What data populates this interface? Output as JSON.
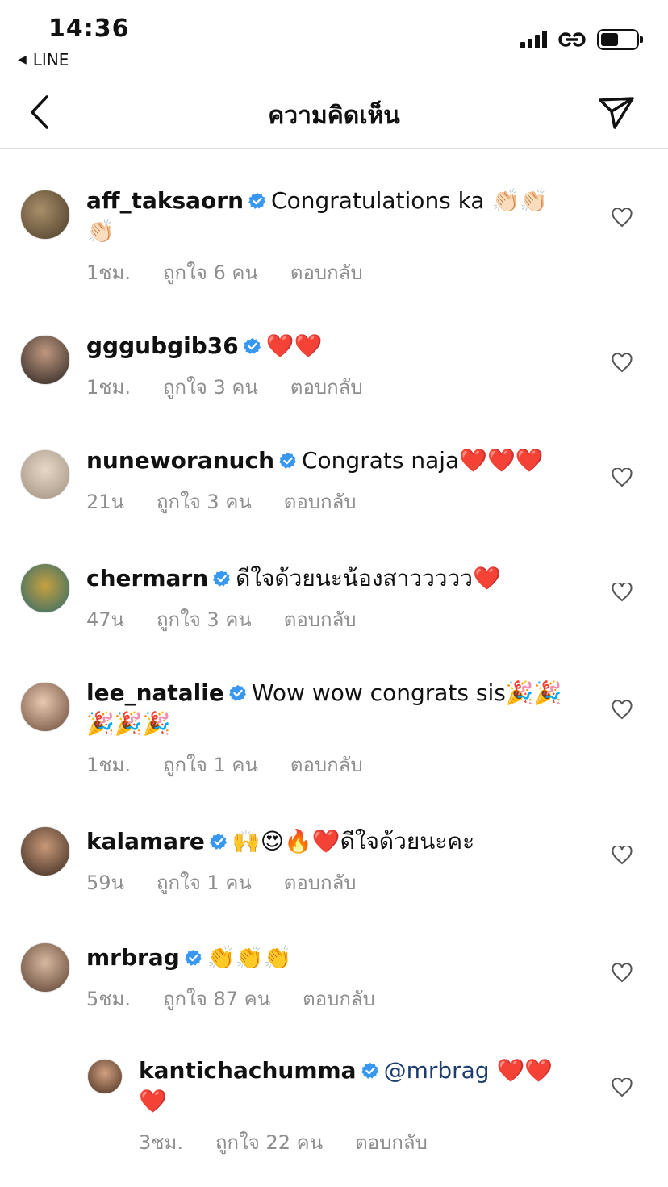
{
  "status_bar": {
    "time": "14:36",
    "back_app": "LINE"
  },
  "header": {
    "title": "ความคิดเห็น"
  },
  "comments": [
    {
      "username": "aff_taksaorn",
      "text": "Congratulations ka 👏🏻👏🏻👏🏻",
      "time": "1ชม.",
      "likes": "ถูกใจ 6 คน",
      "reply": "ตอบกลับ"
    },
    {
      "username": "gggubgib36",
      "text": "❤️❤️",
      "time": "1ชม.",
      "likes": "ถูกใจ 3 คน",
      "reply": "ตอบกลับ"
    },
    {
      "username": "nuneworanuch",
      "text": "Congrats naja❤️❤️❤️",
      "time": "21น",
      "likes": "ถูกใจ 3 คน",
      "reply": "ตอบกลับ"
    },
    {
      "username": "chermarn",
      "text": "ดีใจด้วยนะน้องสาววววว❤️",
      "time": "47น",
      "likes": "ถูกใจ 3 คน",
      "reply": "ตอบกลับ"
    },
    {
      "username": "lee_natalie",
      "text": "Wow wow congrats sis🎉🎉🎉🎉🎉",
      "time": "1ชม.",
      "likes": "ถูกใจ 1 คน",
      "reply": "ตอบกลับ"
    },
    {
      "username": "kalamare",
      "text": "🙌😍🔥❤️ดีใจด้วยนะคะ",
      "time": "59น",
      "likes": "ถูกใจ 1 คน",
      "reply": "ตอบกลับ"
    },
    {
      "username": "mrbrag",
      "text": "👏👏👏",
      "time": "5ชม.",
      "likes": "ถูกใจ 87 คน",
      "reply": "ตอบกลับ"
    }
  ],
  "reply_comment": {
    "username": "kantichachumma",
    "mention": "@mrbrag",
    "text": " ❤️❤️❤️",
    "time": "3ชม.",
    "likes": "ถูกใจ 22 คน",
    "reply": "ตอบกลับ"
  },
  "colors": {
    "verified": "#3897f0",
    "meta": "#8e8e8e",
    "mention": "#1c3d6e",
    "heart_red": "#e0192b"
  }
}
